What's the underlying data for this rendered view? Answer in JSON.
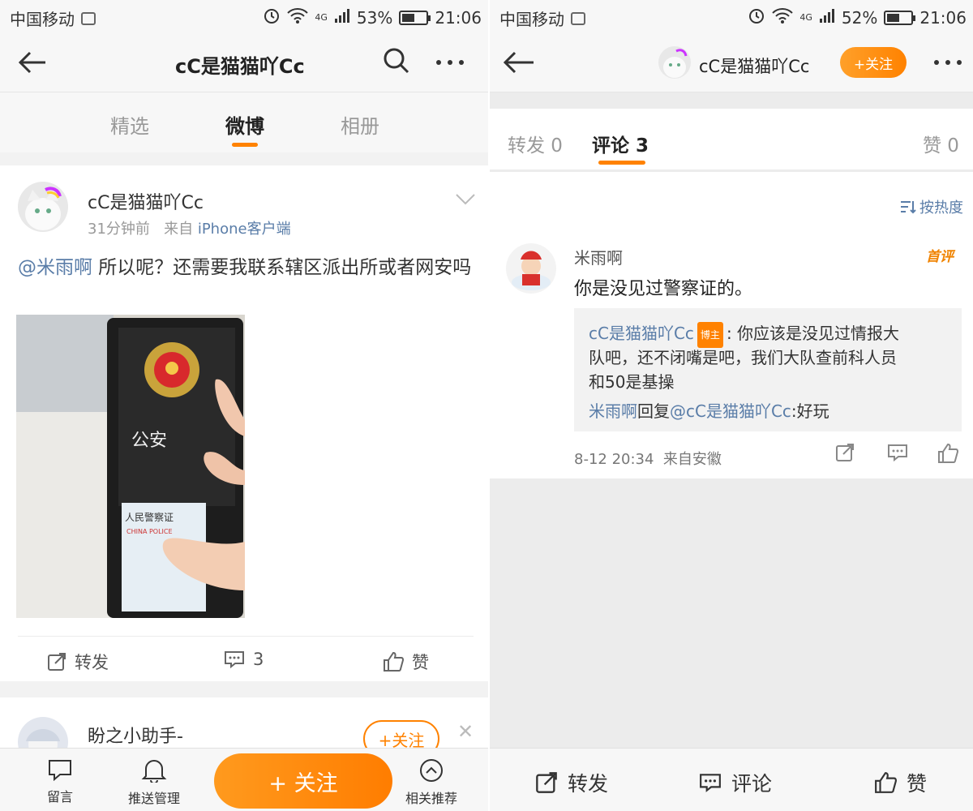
{
  "left": {
    "status": {
      "carrier": "中国移动",
      "network": "4G",
      "battery": "53%",
      "battery_level": 0.53,
      "time": "21:06"
    },
    "header": {
      "title": "cC是猫猫吖Cc"
    },
    "tabs": [
      {
        "label": "精选",
        "active": false
      },
      {
        "label": "微博",
        "active": true
      },
      {
        "label": "相册",
        "active": false
      }
    ],
    "post": {
      "author": "cC是猫猫吖Cc",
      "time": "31分钟前",
      "from_prefix": "来自",
      "source": "iPhone客户端",
      "mention": "@米雨啊",
      "text": " 所以呢？还需要我联系辖区派出所或者网安吗",
      "repost_label": "转发",
      "comment_count": "3",
      "like_label": "赞",
      "photo": {
        "badge_top": "公安",
        "card_title": "人民警察证",
        "card_sub": "CHINA POLICE"
      }
    },
    "suggested": {
      "name": "盼之小助手-",
      "follow_label": "+关注"
    },
    "bottom_bar": {
      "message_label": "留言",
      "push_label": "推送管理",
      "follow_label": "+ 关注",
      "recommend_label": "相关推荐"
    }
  },
  "right": {
    "status": {
      "carrier": "中国移动",
      "network": "4G",
      "battery": "52%",
      "battery_level": 0.52,
      "time": "21:06"
    },
    "header": {
      "title": "cC是猫猫吖Cc",
      "follow_label": "+关注"
    },
    "tabs": {
      "repost": "转发 0",
      "comment": "评论 3",
      "like": "赞 0"
    },
    "sort_label": "按热度",
    "comment": {
      "author": "米雨啊",
      "badge": "首评",
      "text": "你是没见过警察证的。",
      "reply_author": "cC是猫猫吖Cc",
      "reply_badge": "博主",
      "reply_text_1": ": 你应该是没见过情报大",
      "reply_text_2": "队吧，还不闭嘴是吧，我们大队查前科人员",
      "reply_text_3": "和50是基操",
      "reply2_user": "米雨啊",
      "reply2_mid": "回复",
      "reply2_target": "@cC是猫猫吖Cc",
      "reply2_text": ":好玩",
      "time": "8-12 20:34",
      "from": "来自安徽"
    },
    "bottom_bar": {
      "repost": "转发",
      "comment": "评论",
      "like": "赞"
    }
  },
  "colors": {
    "accent": "#ff8200",
    "link": "#5a7da8"
  }
}
